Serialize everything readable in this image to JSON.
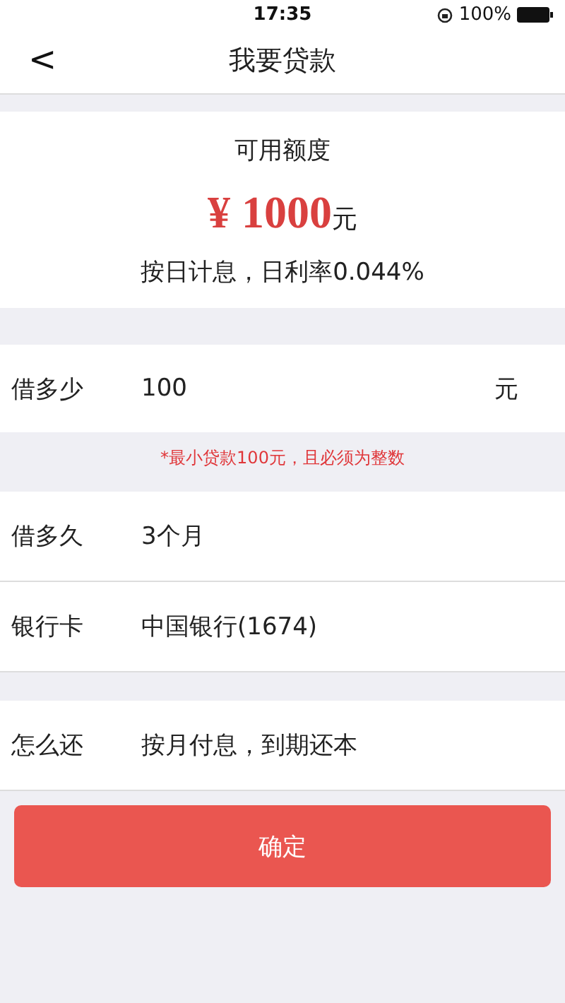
{
  "status_bar": {
    "time": "17:35",
    "battery": "100%"
  },
  "nav": {
    "back": "<",
    "title": "我要贷款"
  },
  "quota": {
    "label": "可用额度",
    "amount": "¥ 1000",
    "unit": "元",
    "rate": "按日计息，日利率0.044%"
  },
  "amount_row": {
    "label": "借多少",
    "value": "100",
    "unit": "元"
  },
  "hint": "*最小贷款100元，且必须为整数",
  "row_groups": [
    [
      {
        "label": "借多久",
        "value": "3个月"
      },
      {
        "label": "银行卡",
        "value": "中国银行(1674)"
      }
    ],
    [
      {
        "label": "怎么还",
        "value": "按月付息，到期还本"
      }
    ]
  ],
  "confirm_button": "确定"
}
